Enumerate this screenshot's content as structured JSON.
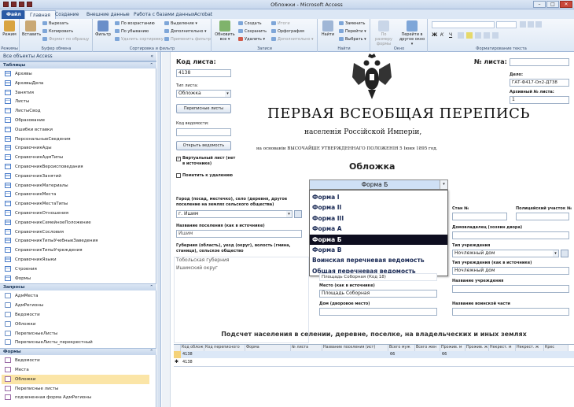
{
  "window": {
    "title": "Обложки  -  Microsoft Access"
  },
  "ribbon_tabs": [
    "Файл",
    "Главная",
    "Создание",
    "Внешние данные",
    "Работа с базами данных",
    "Acrobat"
  ],
  "ribbon": {
    "modes": {
      "view": "Режим",
      "group": "Режимы"
    },
    "clipboard": {
      "paste": "Вставить",
      "cut": "Вырезать",
      "copy": "Копировать",
      "format_painter": "Формат по образцу",
      "group": "Буфер обмена"
    },
    "sort": {
      "filter": "Фильтр",
      "asc": "По возрастанию",
      "desc": "По убыванию",
      "remove_sort": "Удалить сортировку",
      "selection": "Выделение ▾",
      "advanced": "Дополнительно ▾",
      "toggle": "Применить фильтр",
      "group": "Сортировка и фильтр"
    },
    "records": {
      "refresh": "Обновить все ▾",
      "new": "Создать",
      "save": "Сохранить",
      "delete": "Удалить ▾",
      "totals": "Итоги",
      "spelling": "Орфография",
      "more": "Дополнительно ▾",
      "group": "Записи"
    },
    "find": {
      "find": "Найти",
      "replace": "Заменить",
      "goto": "Перейти ▾",
      "select": "Выбрать ▾",
      "group": "Найти"
    },
    "window": {
      "size": "По размеру формы",
      "switch": "Перейти в другое окно ▾",
      "group": "Окно"
    },
    "text": {
      "group": "Форматирование текста"
    }
  },
  "nav": {
    "header": "Все объекты Access",
    "sections": [
      {
        "title": "Таблицы",
        "items": [
          "Архивы",
          "АрхивыДела",
          "Занятия",
          "Листы",
          "ЛистыСвод",
          "Образование",
          "Ошибки вставки",
          "ПерсональныеСведения",
          "СправочникАды",
          "СправочникАдмТипы",
          "СправочникВероисповедания",
          "СправочникЗанятий",
          "СправочникМатериалы",
          "СправочникМеста",
          "СправочникМестаТипы",
          "СправочникОтношения",
          "СправочникСемейноеПоложение",
          "СправочникСословия",
          "СправочникТипыУчебныеЗаведения",
          "СправочникТипыУчреждения",
          "СправочникЯзыки",
          "Строения",
          "Формы"
        ]
      },
      {
        "title": "Запросы",
        "items": [
          "АдмМеста",
          "АдмРегионы",
          "Ведомости",
          "Обложки",
          "ПереписныеЛисты",
          "ПереписныеЛисты_перекрестный"
        ]
      },
      {
        "title": "Формы",
        "items": [
          "Ведомости",
          "Места",
          "Обложки",
          "Переписные листы",
          "подчиненная форма АдмРегионы"
        ]
      }
    ],
    "selected": "Обложки"
  },
  "form": {
    "kod_lista_label": "Код листа:",
    "kod_lista_value": "4138",
    "tip_lista_label": "Тип листа:",
    "tip_lista_value": "Обложка",
    "btn_perepisnye": "Переписные листы",
    "kod_vedomosti_label": "Код ведомости:",
    "btn_otkryt": "Открыть ведомость",
    "virtual_label": "Виртуальный лист (нет в источнике)",
    "delete_label": "Пометить к удалению",
    "nomer_lista_label": "№ листа:",
    "delo_label": "Дело:",
    "delo_value": "ГАТ-Ф417-Оп2-Д738",
    "arch_label": "Архивный № листа:",
    "arch_value": "1",
    "title1": "ПЕРВАЯ ВСЕОБЩАЯ ПЕРЕПИСЬ",
    "title2": "населенія Россійской Имперіи,",
    "title3": "на основаніи ВЫСОЧАЙШЕ УТВЕРЖДЕННАГО ПОЛОЖЕНІЯ 5 Іюня 1895 год.",
    "heading": "Обложка",
    "forma_value": "Форма Б",
    "forma_options": [
      "Форма I",
      "Форма II",
      "Форма III",
      "Форма А",
      "Форма Б",
      "Форма В",
      "Воинская перечневая ведомость",
      "Общая перечневая ведомость"
    ],
    "forma_highlighted": "Форма Б",
    "gorod_label": "Город (посад, местечко), село (деревня, другое поселение на землях сельского общества)",
    "gorod_value": "г. Ишим",
    "naz_pos_label": "Название поселения (как в источнике)",
    "naz_pos_value": "Ишим",
    "gub_label": "Губерния (область), уезд (округ), волость (гмина, станица), сельское общество",
    "gub_value1": "Тобольская губерния",
    "gub_value2": "Ишимский округ",
    "ulitsa_value": "Площадь  Соборная   (Код 18)",
    "mesto_label": "Место (как в источнике)",
    "mesto_value": "Площадь Соборная",
    "dom_label": "Дом (дворовое место)",
    "stan_label": "Стан №",
    "uchastok_label": "Полицейский участок №",
    "domovl_label": "Домовладелец (хозяин двора)",
    "tip_uchr_label": "Тип учреждения",
    "tip_uchr_value": "Ночлежный дом",
    "tip_uchr_src_label": "Тип учреждения (как в источнике)",
    "tip_uchr_src_value": "Ночлежный дом",
    "naz_uchr_label": "Название учреждения",
    "voin_label": "Название воинской части",
    "podschet": "Подсчет населения в селении, деревне, поселке, на владельческих и иных землях"
  },
  "grid": {
    "columns": [
      "Код облож",
      "Код переписного",
      "Форма",
      "№ листа",
      "Название поселения (ист)",
      "Всего муж",
      "Всего жен",
      "Прожив. м",
      "Прожив. ж",
      "Некрест. м",
      "Некрест. ж",
      "Крес"
    ],
    "rows": [
      {
        "kod": "4138",
        "vsego_m": "66",
        "prozh_m": "66"
      },
      {
        "kod": "4138"
      }
    ],
    "new_row_marker": "✱"
  },
  "colors": {
    "accent": "#2a5aa5",
    "selection": "#fbe5a7",
    "dropdown_highlight": "#0e0e20"
  }
}
